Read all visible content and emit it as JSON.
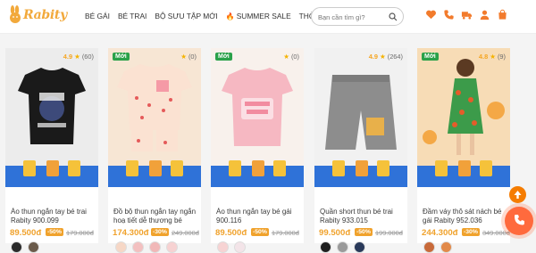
{
  "brand": {
    "name": "Rabity"
  },
  "nav": {
    "items": [
      "BÉ GÁI",
      "BÉ TRAI",
      "BỘ SƯU TẬP MỚI",
      "SUMMER SALE",
      "THỎ CHIA SẺ"
    ]
  },
  "search": {
    "placeholder": "Bạn cần tìm gì?"
  },
  "header_icons": [
    "heart-icon",
    "phone-icon",
    "truck-icon",
    "user-icon",
    "cart-icon"
  ],
  "products": [
    {
      "name": "Áo thun ngắn tay bé trai Rabity 900.099",
      "price": "89.500đ",
      "discount": "-50%",
      "old_price": "179.000đ",
      "rating": "4.9",
      "reviews": "(60)",
      "is_new": false,
      "img_bg": "#ececec",
      "swatches": [
        "#2b2b2b",
        "#6b5b4b"
      ]
    },
    {
      "name": "Đồ bộ thun ngắn tay ngắn hoạ tiết dễ thương bé gái...",
      "price": "174.300đ",
      "discount": "-30%",
      "old_price": "249.000đ",
      "rating": "",
      "reviews": "(0)",
      "is_new": true,
      "new_label": "Mới",
      "img_bg": "#f7e6d4",
      "swatches": [
        "#f6d7c6",
        "#f3c0c0",
        "#f1b8b8",
        "#f7d2d2"
      ]
    },
    {
      "name": "Áo thun ngắn tay bé gái 900.116",
      "price": "89.500đ",
      "discount": "-50%",
      "old_price": "179.000đ",
      "rating": "",
      "reviews": "(0)",
      "is_new": true,
      "new_label": "Mới",
      "img_bg": "#f8f1ec",
      "swatches": [
        "#f7d3d3",
        "#f3e4e8"
      ]
    },
    {
      "name": "Quần short thun bé trai Rabity 933.015",
      "price": "99.500đ",
      "discount": "-50%",
      "old_price": "199.000đ",
      "rating": "4.9",
      "reviews": "(264)",
      "is_new": false,
      "img_bg": "#f1f1f1",
      "swatches": [
        "#1f1f1f",
        "#9a9a9a",
        "#2a3a5a"
      ]
    },
    {
      "name": "Đầm váy thô sát nách bé gái Rabity 952.036",
      "price": "244.300đ",
      "discount": "-30%",
      "old_price": "349.000đ",
      "rating": "4.8",
      "reviews": "(9)",
      "is_new": true,
      "new_label": "Mới",
      "img_bg": "#f7dcb6",
      "swatches": [
        "#c86a3a",
        "#e28a4a"
      ]
    }
  ],
  "colors": {
    "accent": "#f0a22c",
    "new_badge": "#2aa14a",
    "promo": "#2f72d8"
  }
}
